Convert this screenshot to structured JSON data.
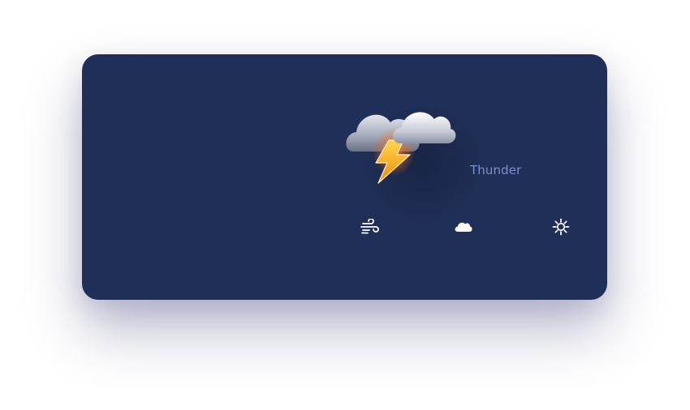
{
  "widget": {
    "condition_label": "Thunder",
    "main_icon": "thunderstorm-icon",
    "background_color": "#202f57",
    "label_color": "#7c8fcf"
  },
  "options": [
    {
      "name": "wind",
      "icon": "wind-icon"
    },
    {
      "name": "cloud",
      "icon": "cloud-icon"
    },
    {
      "name": "sun",
      "icon": "sun-icon"
    }
  ]
}
